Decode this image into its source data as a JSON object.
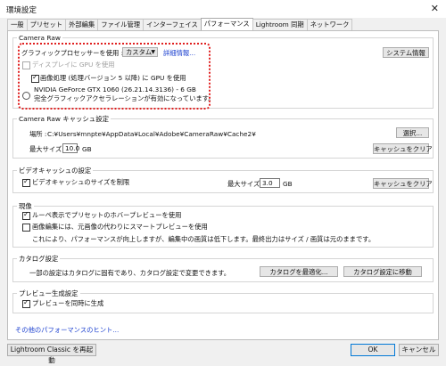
{
  "window": {
    "title": "環境設定",
    "close_glyph": "✕"
  },
  "tabs": [
    {
      "label": "一般",
      "active": false
    },
    {
      "label": "プリセット",
      "active": false
    },
    {
      "label": "外部編集",
      "active": false
    },
    {
      "label": "ファイル管理",
      "active": false
    },
    {
      "label": "インターフェイス",
      "active": false
    },
    {
      "label": "パフォーマンス",
      "active": true
    },
    {
      "label": "Lightroom 同期",
      "active": false
    },
    {
      "label": "ネットワーク",
      "active": false
    }
  ],
  "camera_raw": {
    "legend": "Camera Raw",
    "gpu_label": "グラフィックプロセッサーを使用 :",
    "gpu_select_value": "カスタム",
    "details_link": "詳細情報...",
    "system_info_button": "システム情報",
    "display_gpu_label": "ディスプレイに GPU を使用",
    "display_gpu_checked": false,
    "image_processing_label": "画像処理 (処理バージョン 5 以降) に GPU を使用",
    "image_processing_checked": true,
    "gpu_name": "NVIDIA GeForce GTX 1060 (26.21.14.3136) - 6 GB",
    "gpu_status": "完全グラフィックアクセラレーションが有効になっています。",
    "highlight_color": "#e02020"
  },
  "cache": {
    "legend": "Camera Raw キャッシュ設定",
    "location_label": "場所 :",
    "location_path": "C:¥Users¥mnpte¥AppData¥Local¥Adobe¥CameraRaw¥Cache2¥",
    "choose_button": "選択...",
    "max_size_label": "最大サイズ :",
    "max_size_value": "10.0",
    "unit": "GB",
    "clear_button": "キャッシュをクリア"
  },
  "video_cache": {
    "legend": "ビデオキャッシュの設定",
    "limit_label": "ビデオキャッシュのサイズを制限",
    "limit_checked": true,
    "max_size_label": "最大サイズ :",
    "max_size_value": "3.0",
    "unit": "GB",
    "clear_button": "キャッシュをクリア"
  },
  "develop": {
    "legend": "現像",
    "loupe_label": "ルーペ表示でプリセットのホバープレビューを使用",
    "loupe_checked": true,
    "smart_preview_label": "画像編集には、元画像の代わりにスマートプレビューを使用",
    "smart_preview_checked": false,
    "note": "これにより、パフォーマンスが向上しますが、編集中の画質は低下します。最終出力はサイズ / 画質は元のままです。"
  },
  "catalog": {
    "legend": "カタログ設定",
    "note": "一部の設定はカタログに固有であり、カタログ設定で変更できます。",
    "optimize_button": "カタログを最適化...",
    "go_button": "カタログ設定に移動"
  },
  "preview": {
    "legend": "プレビュー生成設定",
    "parallel_label": "プレビューを同時に生成",
    "parallel_checked": true
  },
  "hint_link": "その他のパフォーマンスのヒント...",
  "footer": {
    "restart_button": "Lightroom Classic を再起動",
    "ok_button": "OK",
    "cancel_button": "キャンセル"
  }
}
